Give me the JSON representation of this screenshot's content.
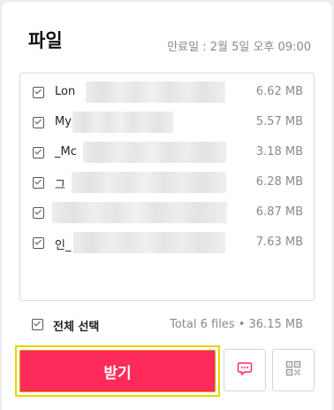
{
  "header": {
    "title": "파일",
    "expiry": "만료일 : 2월 5일 오후 09:00"
  },
  "files": [
    {
      "name": "Lon",
      "size": "6.62 MB",
      "checked": true
    },
    {
      "name": "My",
      "size": "5.57 MB",
      "checked": true
    },
    {
      "name": "_Mc",
      "size": "3.18 MB",
      "checked": true
    },
    {
      "name": "그 ",
      "size": "6.28 MB",
      "checked": true
    },
    {
      "name": "",
      "size": "6.87 MB",
      "checked": true
    },
    {
      "name": "인_",
      "size": "7.63 MB",
      "checked": true
    }
  ],
  "footer": {
    "select_all_label": "전체 선택",
    "total": "Total 6 files • 36.15 MB"
  },
  "actions": {
    "download_label": "받기",
    "chat_icon": "chat-icon",
    "qr_icon": "qr-code-icon"
  },
  "colors": {
    "accent": "#ff2c5b",
    "highlight": "#e8d400"
  }
}
